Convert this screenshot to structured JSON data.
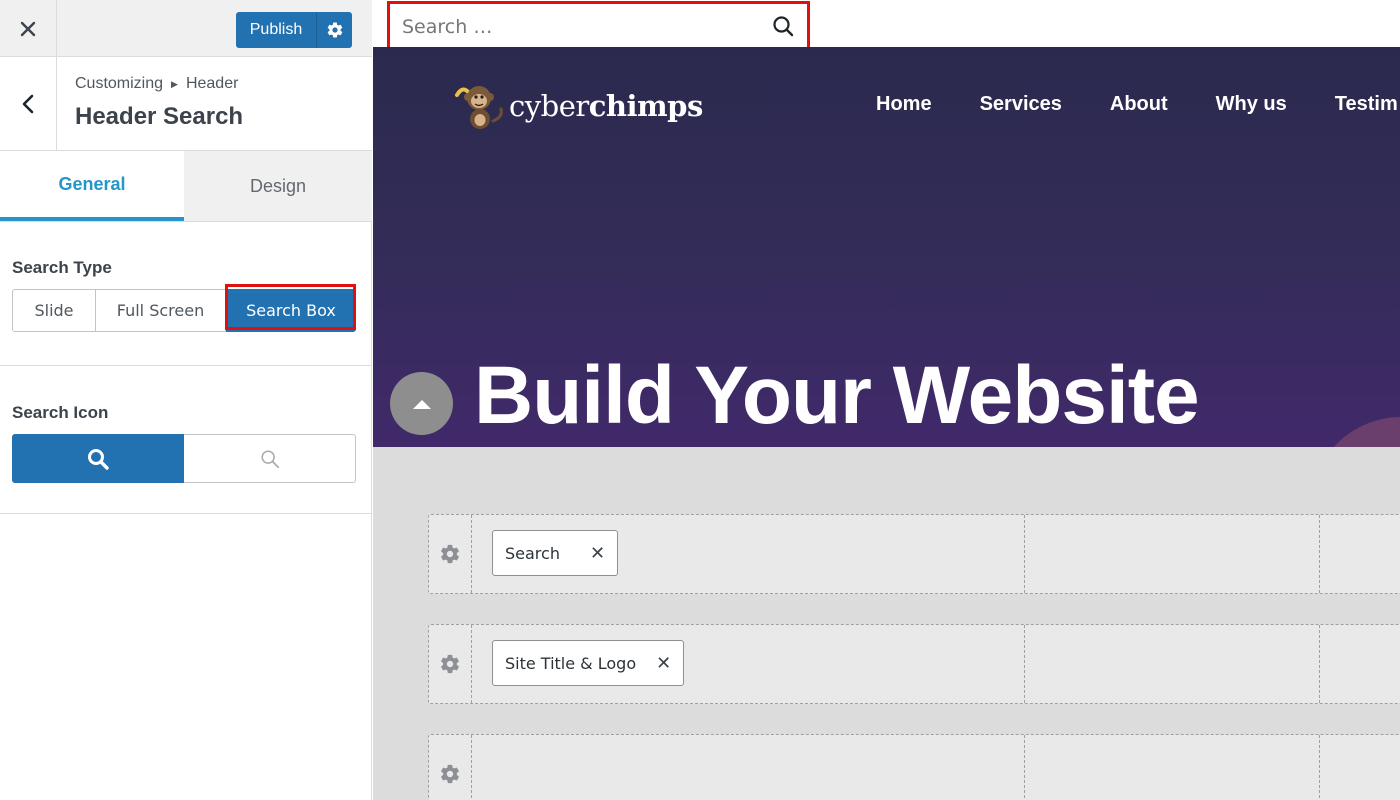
{
  "panel": {
    "publish_label": "Publish",
    "breadcrumb": {
      "parent": "Customizing",
      "current": "Header"
    },
    "section_title": "Header Search",
    "tabs": [
      {
        "label": "General",
        "active": true
      },
      {
        "label": "Design",
        "active": false
      }
    ],
    "search_type": {
      "label": "Search Type",
      "options": [
        "Slide",
        "Full Screen",
        "Search Box"
      ],
      "selected": "Search Box"
    },
    "search_icon": {
      "label": "Search Icon",
      "options": [
        "search-bold-icon",
        "search-thin-icon"
      ],
      "selected": "search-bold-icon"
    }
  },
  "preview": {
    "search": {
      "placeholder": "Search …"
    },
    "logo": {
      "text_light": "cyber",
      "text_bold": "chimps"
    },
    "nav": [
      "Home",
      "Services",
      "About",
      "Why us",
      "Testim"
    ],
    "hero_title": "Build Your Website",
    "builder_rows": [
      {
        "chip": "Search"
      },
      {
        "chip": "Site Title & Logo"
      },
      {
        "chip": ""
      }
    ]
  },
  "colors": {
    "accent": "#2271b1",
    "tab_active": "#2496c9",
    "highlight": "#e01010",
    "hero_top": "#2b2a4e",
    "hero_bottom": "#41296a"
  }
}
